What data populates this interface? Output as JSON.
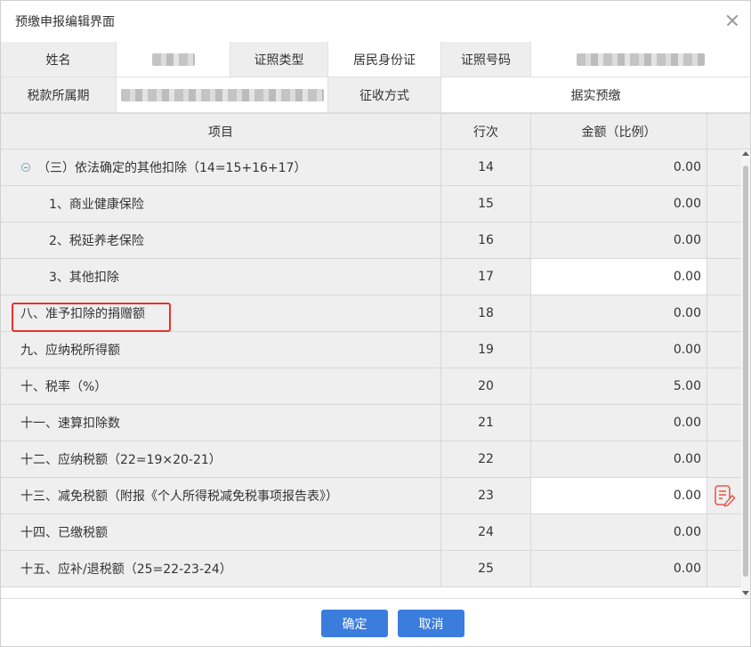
{
  "dialog": {
    "title": "预缴申报编辑界面"
  },
  "info": {
    "name_label": "姓名",
    "id_type_label": "证照类型",
    "id_type_value": "居民身份证",
    "id_number_label": "证照号码",
    "period_label": "税款所属期",
    "method_label": "征收方式",
    "method_value": "据实预缴"
  },
  "table": {
    "headers": {
      "item": "项目",
      "line": "行次",
      "amount": "金额（比例）"
    },
    "rows": [
      {
        "item": "（三）依法确定的其他扣除（14=15+16+17）",
        "line": "14",
        "amount": "0.00"
      },
      {
        "item": "1、商业健康保险",
        "line": "15",
        "amount": "0.00"
      },
      {
        "item": "2、税延养老保险",
        "line": "16",
        "amount": "0.00"
      },
      {
        "item": "3、其他扣除",
        "line": "17",
        "amount": "0.00"
      },
      {
        "item": "八、准予扣除的捐赠额",
        "line": "18",
        "amount": "0.00"
      },
      {
        "item": "九、应纳税所得额",
        "line": "19",
        "amount": "0.00"
      },
      {
        "item": "十、税率（%）",
        "line": "20",
        "amount": "5.00"
      },
      {
        "item": "十一、速算扣除数",
        "line": "21",
        "amount": "0.00"
      },
      {
        "item": "十二、应纳税额（22=19×20-21）",
        "line": "22",
        "amount": "0.00"
      },
      {
        "item": "十三、减免税额（附报《个人所得税减免税事项报告表》）",
        "line": "23",
        "amount": "0.00"
      },
      {
        "item": "十四、已缴税额",
        "line": "24",
        "amount": "0.00"
      },
      {
        "item": "十五、应补/退税额（25=22-23-24）",
        "line": "25",
        "amount": "0.00"
      }
    ]
  },
  "footer": {
    "confirm_label": "确定",
    "cancel_label": "取消"
  },
  "colors": {
    "primary": "#3b7ddd",
    "highlight": "#e8322b",
    "edit_icon": "#e8584f"
  }
}
